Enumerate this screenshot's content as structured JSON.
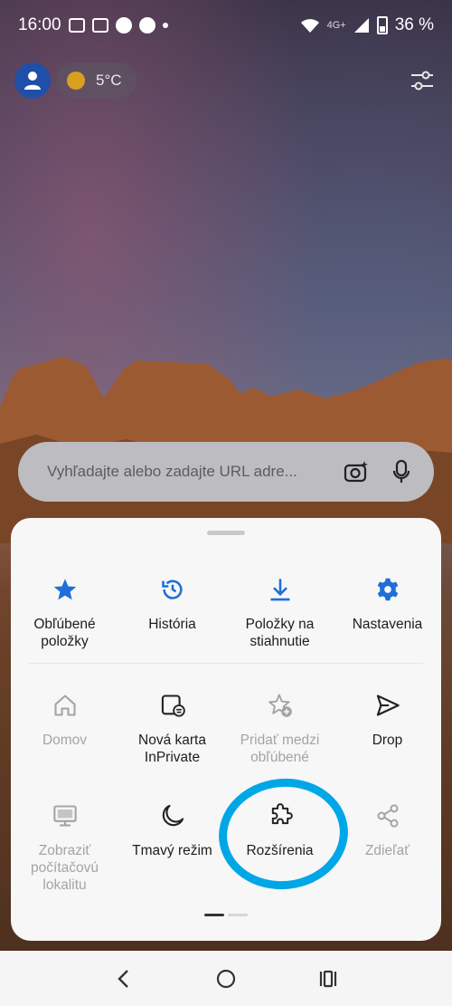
{
  "status_bar": {
    "time": "16:00",
    "network": "4G+",
    "battery": "36 %"
  },
  "top": {
    "temperature": "5°C"
  },
  "search": {
    "placeholder": "Vyhľadajte alebo zadajte URL adre..."
  },
  "menu": {
    "row1": [
      {
        "label": "Obľúbené položky",
        "icon": "star-icon",
        "enabled": true
      },
      {
        "label": "História",
        "icon": "history-icon",
        "enabled": true
      },
      {
        "label": "Položky na stiahnutie",
        "icon": "download-icon",
        "enabled": true
      },
      {
        "label": "Nastavenia",
        "icon": "gear-icon",
        "enabled": true
      }
    ],
    "row2": [
      {
        "label": "Domov",
        "icon": "home-icon",
        "enabled": false
      },
      {
        "label": "Nová karta InPrivate",
        "icon": "inprivate-tab-icon",
        "enabled": true
      },
      {
        "label": "Pridať medzi obľúbené",
        "icon": "add-favorite-icon",
        "enabled": false
      },
      {
        "label": "Drop",
        "icon": "send-icon",
        "enabled": true
      }
    ],
    "row3": [
      {
        "label": "Zobraziť počítačovú lokalitu",
        "icon": "desktop-icon",
        "enabled": false
      },
      {
        "label": "Tmavý režim",
        "icon": "moon-icon",
        "enabled": true
      },
      {
        "label": "Rozšírenia",
        "icon": "puzzle-icon",
        "enabled": true
      },
      {
        "label": "Zdieľať",
        "icon": "share-icon",
        "enabled": false
      }
    ]
  },
  "colors": {
    "accent": "#1f6fd8",
    "highlight_annotation": "#00a7e6"
  }
}
